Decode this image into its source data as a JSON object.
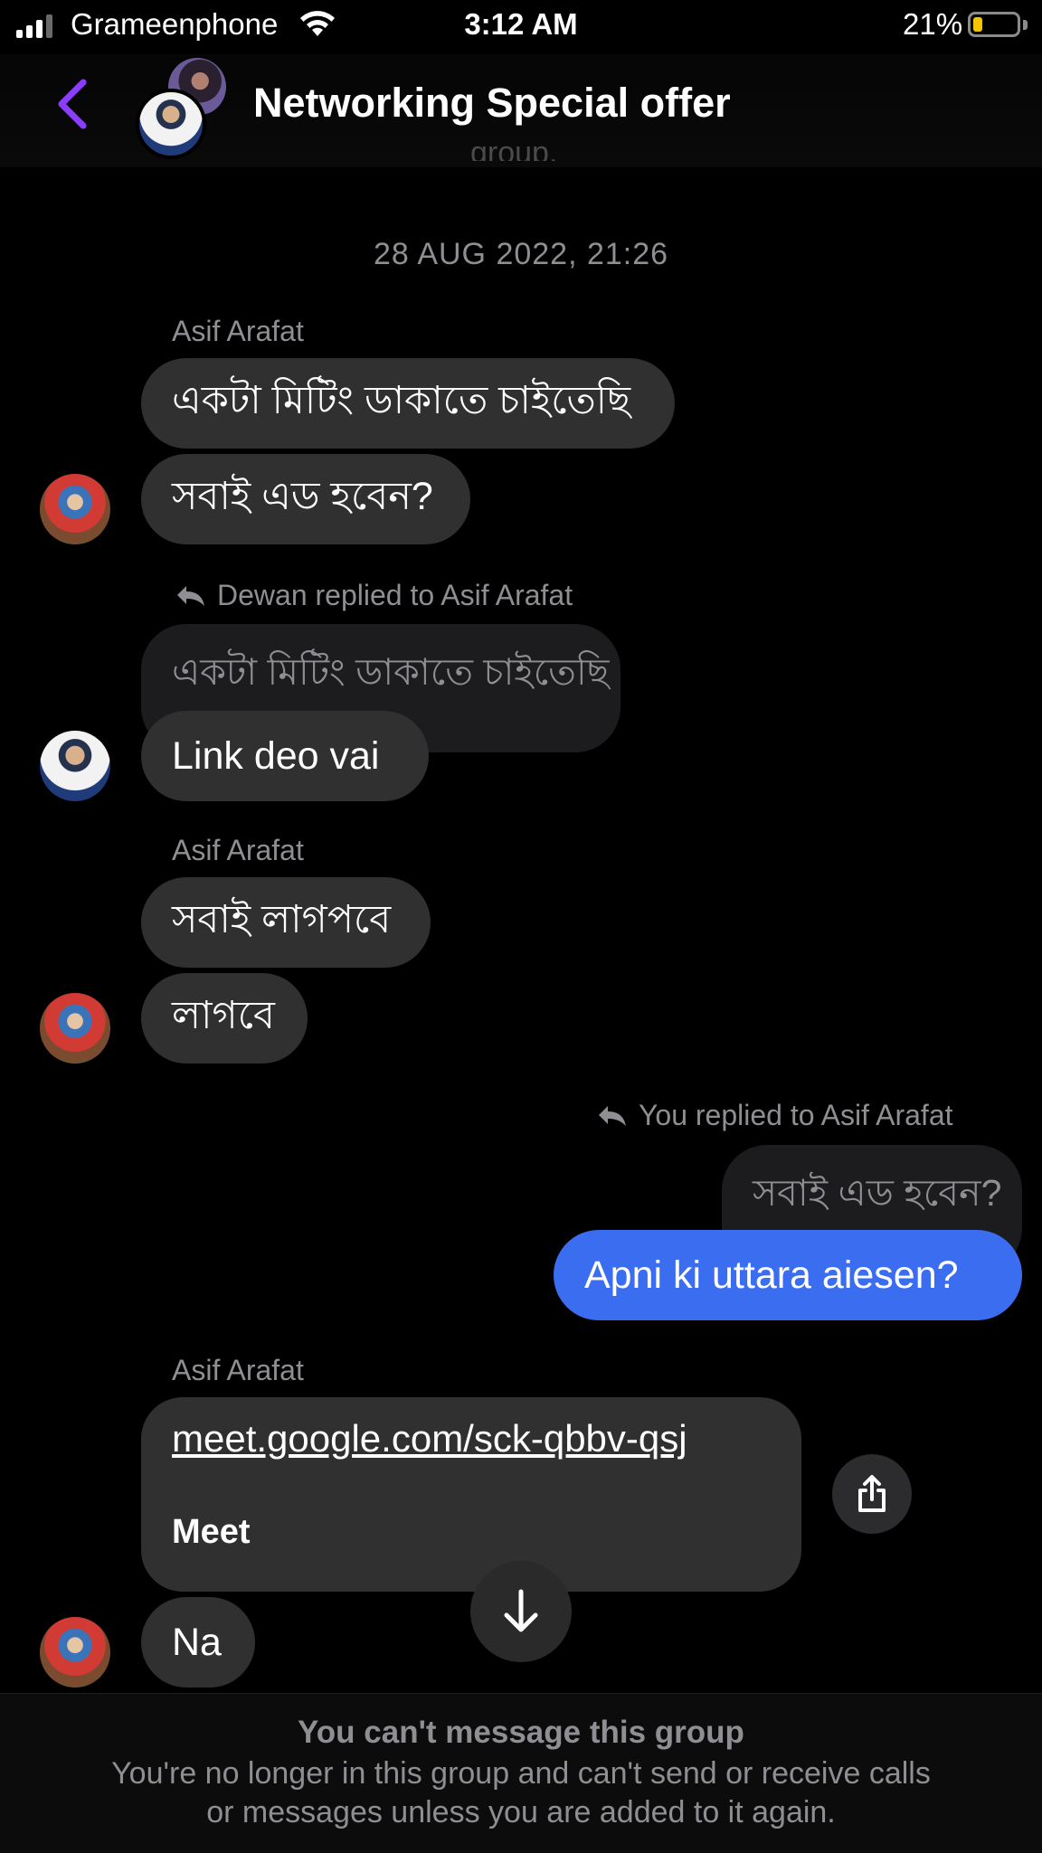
{
  "status_bar": {
    "carrier": "Grameenphone",
    "time": "3:12 AM",
    "battery_percent": "21%"
  },
  "header": {
    "title": "Networking Special offer",
    "cut_off_text": "group."
  },
  "conversation": {
    "timestamp": "28 AUG 2022, 21:26",
    "group1": {
      "sender": "Asif Arafat",
      "messages": [
        "একটা মিটিং ডাকাতে চাইতেছি",
        "সবাই এড হবেন?"
      ]
    },
    "group2": {
      "reply_label": "Dewan replied to Asif Arafat",
      "quoted": "একটা মিটিং ডাকাতে চাইতেছি",
      "message": "Link deo vai"
    },
    "group3": {
      "sender": "Asif Arafat",
      "messages": [
        "সবাই লাগপবে",
        "লাগবে"
      ]
    },
    "group4": {
      "reply_label": "You replied to Asif Arafat",
      "quoted": "সবাই এড হবেন?",
      "message": "Apni ki uttara aiesen?"
    },
    "group5": {
      "sender": "Asif Arafat",
      "link_url": "meet.google.com/sck-qbbv-qsj",
      "link_title": "Meet",
      "message": "Na"
    }
  },
  "footer": {
    "title": "You can't message this group",
    "line1": "You're no longer in this group and can't send or receive calls",
    "line2": "or messages unless you are added to it again."
  },
  "colors": {
    "accent": "#8b3dff",
    "my_bubble": "#3a6df0",
    "their_bubble": "#303030",
    "muted_text": "#8e8e93"
  }
}
